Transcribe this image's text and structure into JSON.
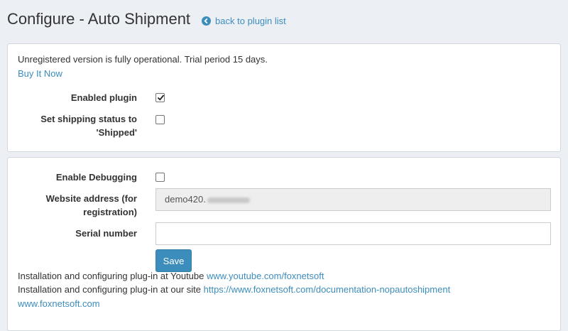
{
  "header": {
    "title": "Configure - Auto Shipment",
    "back_link": "back to plugin list"
  },
  "license": {
    "notice": "Unregistered version is fully operational. Trial period 15 days.",
    "buy_link": "Buy It Now"
  },
  "general": {
    "enabled_label": "Enabled plugin",
    "enabled_checked": true,
    "shipped_label_line1": "Set shipping status to",
    "shipped_label_line2": "'Shipped'",
    "shipped_checked": false
  },
  "settings": {
    "debug_label": "Enable Debugging",
    "debug_checked": false,
    "website_label_line1": "Website address (for",
    "website_label_line2": "registration)",
    "website_value_prefix": "demo420.",
    "serial_label": "Serial number",
    "serial_value": "",
    "save_label": "Save"
  },
  "footer": {
    "youtube_text": "Installation and configuring plug-in at Youtube ",
    "youtube_link": "www.youtube.com/foxnetsoft",
    "site_text": "Installation and configuring plug-in at our site ",
    "site_link": "https://www.foxnetsoft.com/documentation-nopautoshipment",
    "home_link": "www.foxnetsoft.com"
  },
  "colors": {
    "accent": "#3c8dbc",
    "background": "#ecf0f5"
  }
}
